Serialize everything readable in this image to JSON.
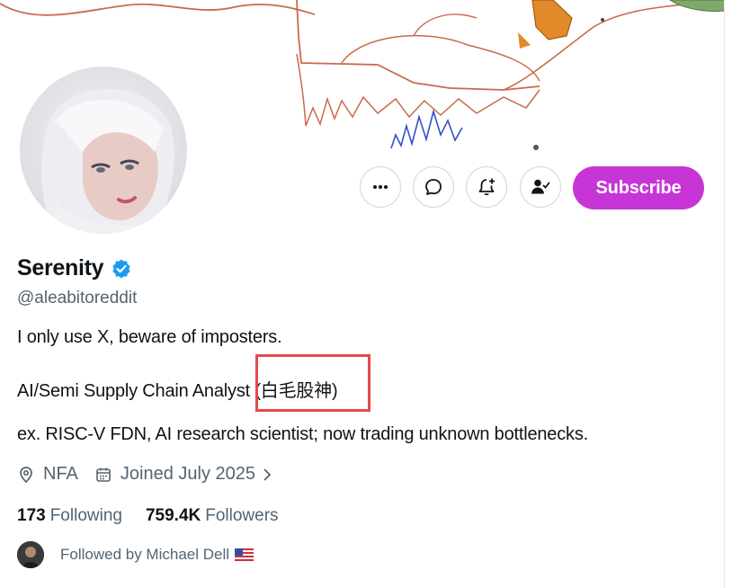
{
  "profile": {
    "name": "Serenity",
    "handle": "@aleabitoreddit",
    "bio_lines": [
      "I only use X, beware of imposters.",
      "AI/Semi Supply Chain Analyst (白毛股神)",
      "ex. RISC-V FDN, AI research scientist; now trading unknown bottlenecks."
    ],
    "location": "NFA",
    "joined": "Joined July 2025",
    "following_count": "173",
    "following_label": "Following",
    "followers_count": "759.4K",
    "followers_label": "Followers",
    "followed_by": "Followed by Michael Dell"
  },
  "actions": {
    "more_icon": "more-horizontal-icon",
    "message_icon": "message-bubble-icon",
    "notify_icon": "bell-plus-icon",
    "following_icon": "person-check-icon",
    "subscribe_label": "Subscribe"
  },
  "colors": {
    "subscribe_bg": "#c735d6",
    "verified": "#1d9bf0",
    "highlight_box": "#e8484b",
    "secondary_text": "#536471"
  }
}
